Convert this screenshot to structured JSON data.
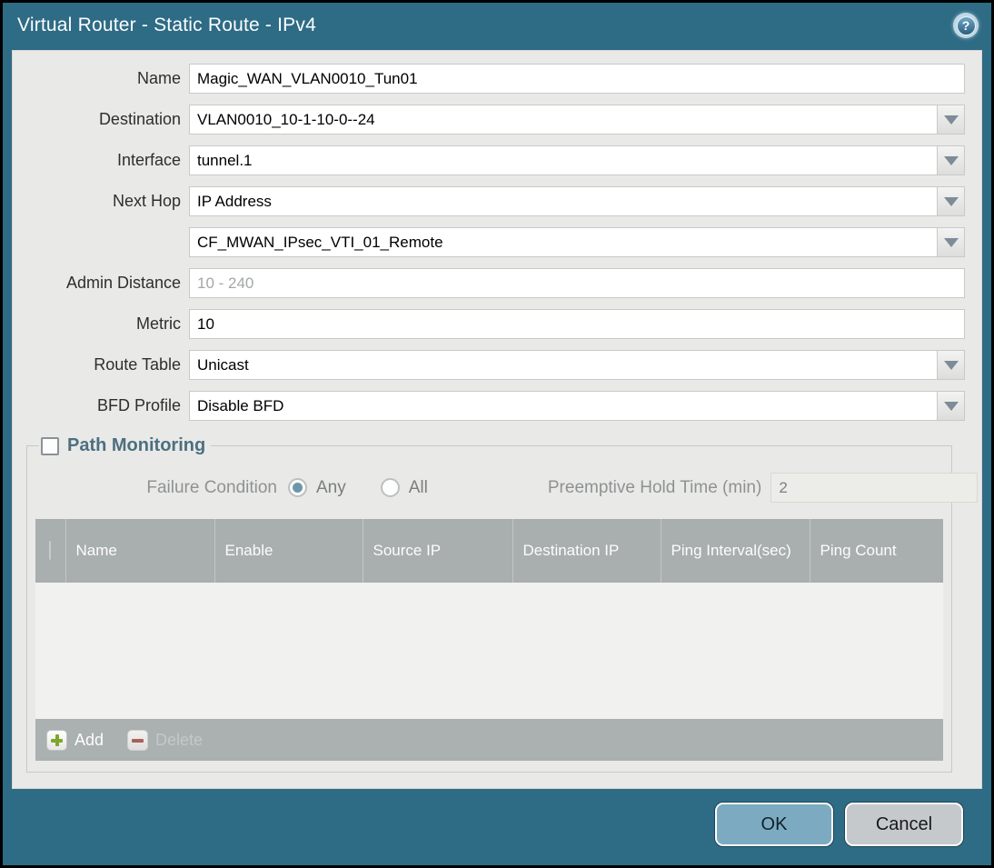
{
  "dialog": {
    "title": "Virtual Router - Static Route - IPv4",
    "help_glyph": "?"
  },
  "form": {
    "name": {
      "label": "Name",
      "value": "Magic_WAN_VLAN0010_Tun01"
    },
    "destination": {
      "label": "Destination",
      "value": "VLAN0010_10-1-10-0--24"
    },
    "interface": {
      "label": "Interface",
      "value": "tunnel.1"
    },
    "next_hop": {
      "label": "Next Hop",
      "value": "IP Address"
    },
    "next_hop_address": {
      "value": "CF_MWAN_IPsec_VTI_01_Remote"
    },
    "admin_distance": {
      "label": "Admin Distance",
      "placeholder": "10 - 240",
      "value": ""
    },
    "metric": {
      "label": "Metric",
      "value": "10"
    },
    "route_table": {
      "label": "Route Table",
      "value": "Unicast"
    },
    "bfd_profile": {
      "label": "BFD Profile",
      "value": "Disable BFD"
    }
  },
  "path_monitoring": {
    "legend": "Path Monitoring",
    "enabled": false,
    "failure_condition": {
      "label": "Failure Condition",
      "options": [
        {
          "label": "Any",
          "selected": true
        },
        {
          "label": "All",
          "selected": false
        }
      ]
    },
    "preemptive_hold_time": {
      "label": "Preemptive Hold Time (min)",
      "value": "2"
    },
    "table": {
      "columns": [
        "Name",
        "Enable",
        "Source IP",
        "Destination IP",
        "Ping Interval(sec)",
        "Ping Count"
      ],
      "rows": []
    },
    "toolbar": {
      "add_label": "Add",
      "delete_label": "Delete",
      "delete_enabled": false
    }
  },
  "footer": {
    "ok_label": "OK",
    "cancel_label": "Cancel"
  },
  "colors": {
    "frame_teal": "#2e6b85",
    "content_bg": "#e9e9e7",
    "table_header_gray": "#a9aeae",
    "ok_button_blue": "#7cabc1",
    "cancel_button_gray": "#c5c9cb",
    "add_icon_green": "#7fa62c",
    "delete_icon_red": "#a8625a",
    "radio_selected_blue": "#6e96ab",
    "legend_slate": "#4d6f80"
  }
}
